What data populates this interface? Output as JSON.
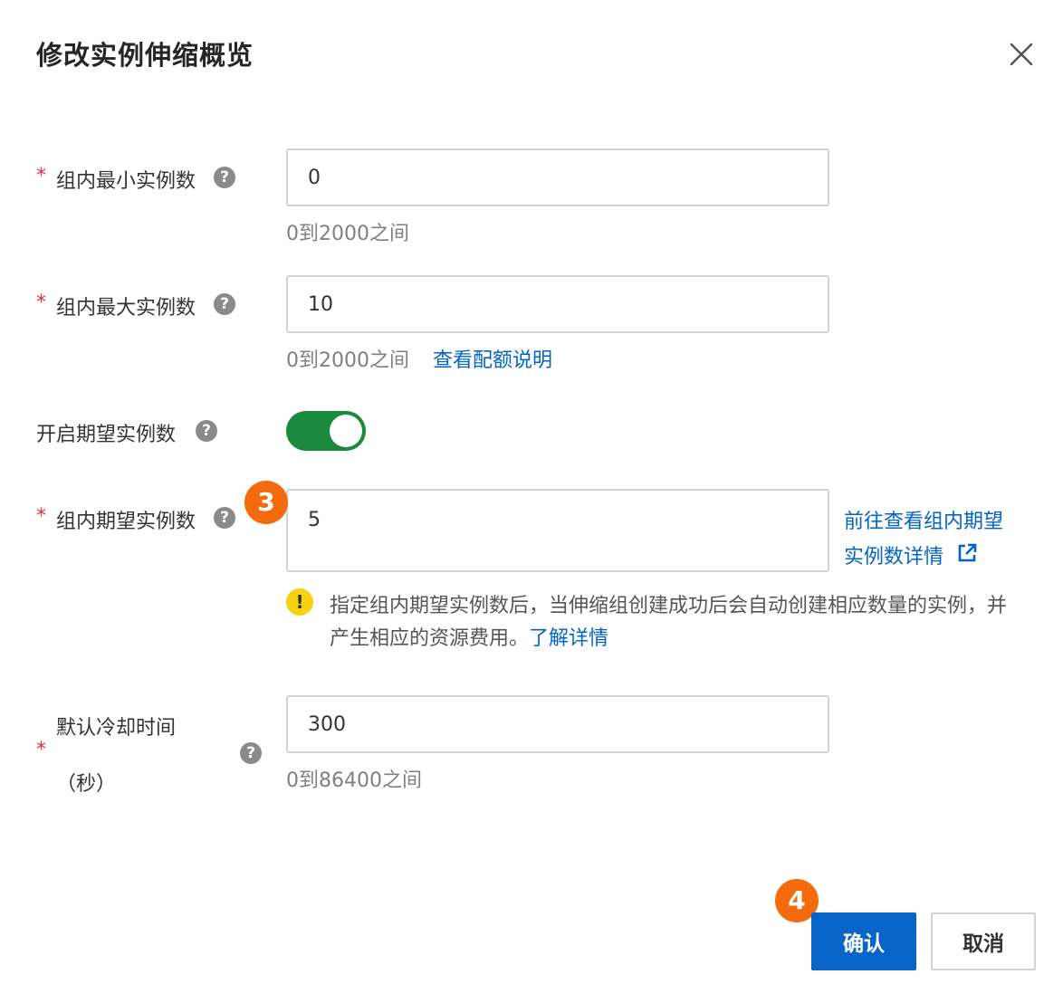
{
  "dialog": {
    "title": "修改实例伸缩概览"
  },
  "fields": {
    "min": {
      "required_mark": "*",
      "label": "组内最小实例数",
      "help_icon": "?",
      "value": "0",
      "hint": "0到2000之间"
    },
    "max": {
      "required_mark": "*",
      "label": "组内最大实例数",
      "help_icon": "?",
      "value": "10",
      "hint": "0到2000之间",
      "link": "查看配额说明"
    },
    "expected_toggle": {
      "label": "开启期望实例数",
      "help_icon": "?",
      "state": "on"
    },
    "expected": {
      "required_mark": "*",
      "label": "组内期望实例数",
      "help_icon": "?",
      "value": "5",
      "link_line1": "前往查看组内期望",
      "link_line2": "实例数详情",
      "warning_icon": "!",
      "warning_text": "指定组内期望实例数后，当伸缩组创建成功后会自动创建相应数量的实例，并产生相应的资源费用。",
      "warning_link": "了解详情"
    },
    "cooldown": {
      "required_mark": "*",
      "label_line1": "默认冷却时间",
      "label_line2": "（秒）",
      "help_icon": "?",
      "value": "300",
      "hint": "0到86400之间"
    }
  },
  "step_badges": {
    "step3": "3",
    "step4": "4"
  },
  "buttons": {
    "confirm": "确认",
    "cancel": "取消"
  },
  "colors": {
    "primary": "#0964c8",
    "link": "#0064c8",
    "toggle_on": "#1b8a3e",
    "required": "#e0323a",
    "step_badge": "#f36b0c",
    "warning": "#f5d310"
  }
}
